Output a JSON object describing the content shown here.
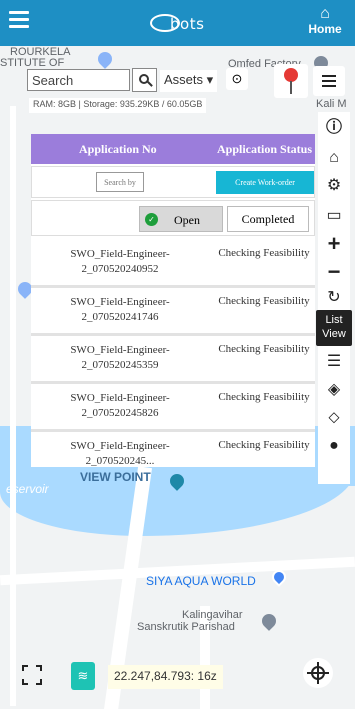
{
  "header": {
    "logo_text": "bots",
    "home_icon": "home-icon",
    "home_label": "Home"
  },
  "map": {
    "labels": {
      "rourkela": "ROURKELA",
      "institute": "STITUTE OF",
      "omfed": "Omfed Factory",
      "kali": "Kali M",
      "view_point": "VIEW POINT",
      "reservoir": "eservoir",
      "siya": "SIYA AQUA WORLD",
      "kalingavihar": "Kalingavihar",
      "sanskrutik": "Sanskrutik Parishad"
    },
    "colors": {
      "water": "#aadaff",
      "land": "#f1f3f4"
    }
  },
  "search": {
    "placeholder": "Search",
    "assets_label": "Assets ▾"
  },
  "stats": {
    "text": "RAM: 8GB | Storage: 935.29KB / 60.05GB"
  },
  "right_toolbar": {
    "list_view_tooltip_line1": "List",
    "list_view_tooltip_line2": "View"
  },
  "panel": {
    "header_app_no": "Application No",
    "header_app_status": "Application Status",
    "filter_placeholder": "Search by",
    "create_label": "Create Work-order",
    "open_label": "Open",
    "completed_label": "Completed",
    "rows": [
      {
        "no_line1": "SWO_Field-Engineer-",
        "no_line2": "2_070520240952",
        "status": "Checking Feasibility"
      },
      {
        "no_line1": "SWO_Field-Engineer-",
        "no_line2": "2_070520241746",
        "status": "Checking Feasibility"
      },
      {
        "no_line1": "SWO_Field-Engineer-",
        "no_line2": "2_070520245359",
        "status": "Checking Feasibility"
      },
      {
        "no_line1": "SWO_Field-Engineer-",
        "no_line2": "2_070520245826",
        "status": "Checking Feasibility"
      },
      {
        "no_line1": "SWO_Field-Engineer-",
        "no_line2": "2_070520245...",
        "status": "Checking Feasibility"
      }
    ],
    "colors": {
      "header": "#9b7ddb",
      "create": "#17b6d4",
      "open_check": "#1e9e3b"
    }
  },
  "bottom": {
    "coords": "22.247,84.793: 16z"
  },
  "theme": {
    "header_blue": "#1e8fc4",
    "layers_teal": "#1ec3b4"
  }
}
